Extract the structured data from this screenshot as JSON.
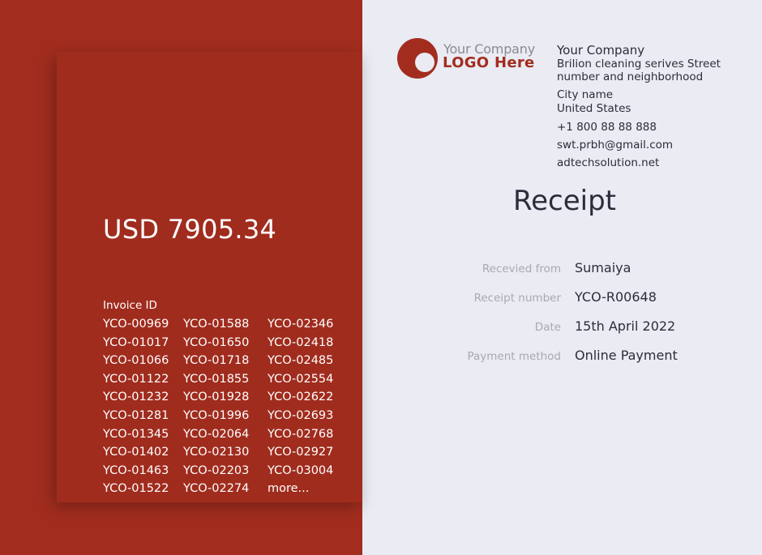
{
  "colors": {
    "accent": "#a22d1e",
    "panel_bg": "#eaebf3",
    "text_dark": "#2b2d3a",
    "text_muted": "#a8a9b2"
  },
  "summary": {
    "amount": "USD 7905.34",
    "invoice_label": "Invoice ID",
    "invoice_ids": [
      "YCO-00969",
      "YCO-01588",
      "YCO-02346",
      "YCO-01017",
      "YCO-01650",
      "YCO-02418",
      "YCO-01066",
      "YCO-01718",
      "YCO-02485",
      "YCO-01122",
      "YCO-01855",
      "YCO-02554",
      "YCO-01232",
      "YCO-01928",
      "YCO-02622",
      "YCO-01281",
      "YCO-01996",
      "YCO-02693",
      "YCO-01345",
      "YCO-02064",
      "YCO-02768",
      "YCO-01402",
      "YCO-02130",
      "YCO-02927",
      "YCO-01463",
      "YCO-02203",
      "YCO-03004",
      "YCO-01522",
      "YCO-02274",
      "more..."
    ]
  },
  "logo": {
    "line1": "Your Company",
    "line2": "LOGO Here",
    "icon": "logo-circle-icon"
  },
  "company": {
    "name": "Your Company",
    "address_line1": "Brilion cleaning serives Street",
    "address_line2": "number and neighborhood",
    "city": "City name",
    "country": "United States",
    "phone": "+1 800 88 88 888",
    "email": "swt.prbh@gmail.com",
    "website": "adtechsolution.net"
  },
  "receipt": {
    "title": "Receipt",
    "fields": [
      {
        "label": "Recevied from",
        "value": "Sumaiya"
      },
      {
        "label": "Receipt number",
        "value": "YCO-R00648"
      },
      {
        "label": "Date",
        "value": "15th April 2022"
      },
      {
        "label": "Payment method",
        "value": "Online Payment"
      }
    ]
  }
}
